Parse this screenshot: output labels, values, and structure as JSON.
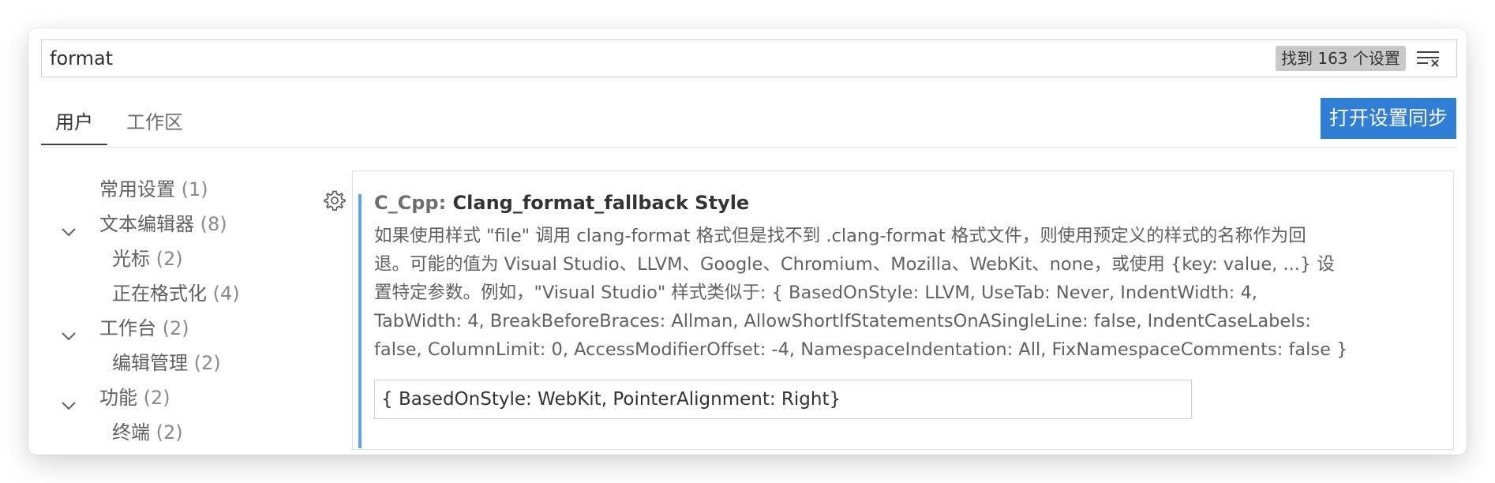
{
  "search": {
    "value": "format",
    "result_count": "找到 163 个设置",
    "clear_icon": "clear-filter-icon"
  },
  "tabs": [
    {
      "label": "用户",
      "active": true
    },
    {
      "label": "工作区",
      "active": false
    }
  ],
  "sync_button": {
    "label": "打开设置同步",
    "color": "#2f7fd6"
  },
  "toc": [
    {
      "label": "常用设置",
      "count": "(1)",
      "expandable": false
    },
    {
      "label": "文本编辑器",
      "count": "(8)",
      "expandable": true
    },
    {
      "label": "光标",
      "count": "(2)",
      "expandable": false
    },
    {
      "label": "正在格式化",
      "count": "(4)",
      "expandable": false
    },
    {
      "label": "工作台",
      "count": "(2)",
      "expandable": true
    },
    {
      "label": "编辑管理",
      "count": "(2)",
      "expandable": false
    },
    {
      "label": "功能",
      "count": "(2)",
      "expandable": true
    },
    {
      "label": "终端",
      "count": "(2)",
      "expandable": false
    }
  ],
  "setting": {
    "category": "C_Cpp: ",
    "name": "Clang_format_fallback Style",
    "description_lines": [
      "如果使用样式 \"file\" 调用 clang-format 格式但是找不到 .clang-format 格式文件，则使用预定义的样式的名称作为回",
      "退。可能的值为 Visual Studio、LLVM、Google、Chromium、Mozilla、WebKit、none，或使用 {key: value, ...} 设",
      "置特定参数。例如，\"Visual Studio\" 样式类似于: { BasedOnStyle: LLVM, UseTab: Never, IndentWidth: 4,",
      "TabWidth: 4, BreakBeforeBraces: Allman, AllowShortIfStatementsOnASingleLine: false, IndentCaseLabels:",
      "false, ColumnLimit: 0, AccessModifierOffset: -4, NamespaceIndentation: All, FixNamespaceComments: false }"
    ],
    "value": "{ BasedOnStyle: WebKit, PointerAlignment: Right}",
    "modified_bar_color": "#5aa4e0"
  }
}
